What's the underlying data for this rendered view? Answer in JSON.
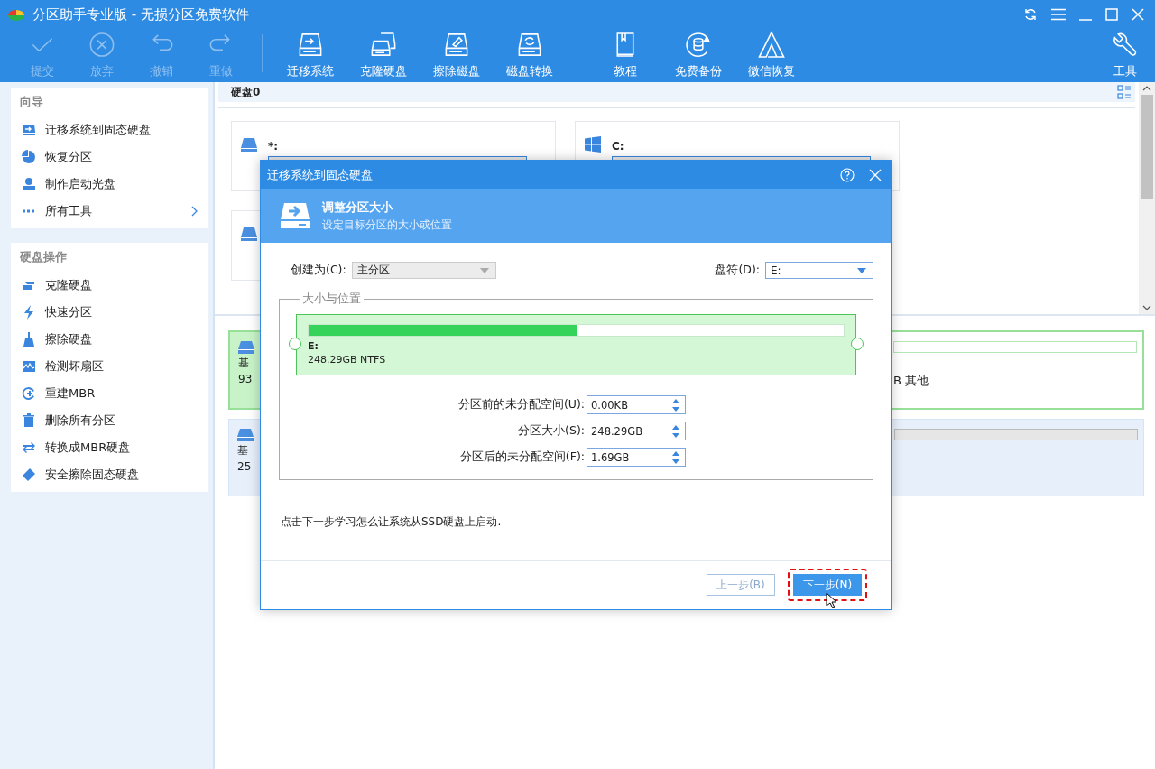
{
  "window": {
    "title": "分区助手专业版 - 无损分区免费软件"
  },
  "toolbar": {
    "groups": [
      [
        {
          "label": "提交",
          "disabled": true
        },
        {
          "label": "放弃",
          "disabled": true
        },
        {
          "label": "撤销",
          "disabled": true
        },
        {
          "label": "重做",
          "disabled": true
        }
      ],
      [
        {
          "label": "迁移系统",
          "disabled": false
        },
        {
          "label": "克隆硬盘",
          "disabled": false
        },
        {
          "label": "擦除磁盘",
          "disabled": false
        },
        {
          "label": "磁盘转换",
          "disabled": false
        }
      ],
      [
        {
          "label": "教程",
          "disabled": false
        },
        {
          "label": "免费备份",
          "disabled": false
        },
        {
          "label": "微信恢复",
          "disabled": false
        }
      ]
    ],
    "tools": {
      "label": "工具"
    }
  },
  "sidebar": {
    "sections": [
      {
        "title": "向导",
        "items": [
          {
            "label": "迁移系统到固态硬盘",
            "has_submenu": false
          },
          {
            "label": "恢复分区",
            "has_submenu": false
          },
          {
            "label": "制作启动光盘",
            "has_submenu": false
          },
          {
            "label": "所有工具",
            "has_submenu": true
          }
        ]
      },
      {
        "title": "硬盘操作",
        "items": [
          {
            "label": "克隆硬盘",
            "has_submenu": false
          },
          {
            "label": "快速分区",
            "has_submenu": false
          },
          {
            "label": "擦除硬盘",
            "has_submenu": false
          },
          {
            "label": "检测坏扇区",
            "has_submenu": false
          },
          {
            "label": "重建MBR",
            "has_submenu": false
          },
          {
            "label": "删除所有分区",
            "has_submenu": false
          },
          {
            "label": "转换成MBR硬盘",
            "has_submenu": false
          },
          {
            "label": "安全擦除固态硬盘",
            "has_submenu": false
          }
        ]
      }
    ]
  },
  "disk_view": {
    "title": "硬盘0",
    "partitions": [
      {
        "kind": "data",
        "label": "*:"
      },
      {
        "kind": "system",
        "label": "C:"
      },
      {
        "kind": "data"
      }
    ]
  },
  "disk_rows": [
    {
      "name": "基",
      "size": "93",
      "selected": true,
      "note": "B 其他"
    },
    {
      "name": "基",
      "size": "25",
      "selected": false
    }
  ],
  "dialog": {
    "title": "迁移系统到固态硬盘",
    "heading": "调整分区大小",
    "subheading": "设定目标分区的大小或位置",
    "create_as": {
      "label": "创建为(C):",
      "value": "主分区",
      "disabled": true
    },
    "drive_letter": {
      "label": "盘符(D):",
      "value": "E:",
      "disabled": false
    },
    "group_label": "大小与位置",
    "partition": {
      "name": "E:",
      "info": "248.29GB NTFS",
      "level": 0.5
    },
    "fields": [
      {
        "label": "分区前的未分配空间(U):",
        "value": "0.00KB"
      },
      {
        "label": "分区大小(S):",
        "value": "248.29GB"
      },
      {
        "label": "分区后的未分配空间(F):",
        "value": "1.69GB"
      }
    ],
    "hint": "点击下一步学习怎么让系统从SSD硬盘上启动.",
    "buttons": [
      {
        "label": "上一步(B)",
        "kind": "secondary",
        "disabled": true,
        "highlighted": false
      },
      {
        "label": "下一步(N)",
        "kind": "primary",
        "disabled": false,
        "highlighted": true
      }
    ]
  }
}
